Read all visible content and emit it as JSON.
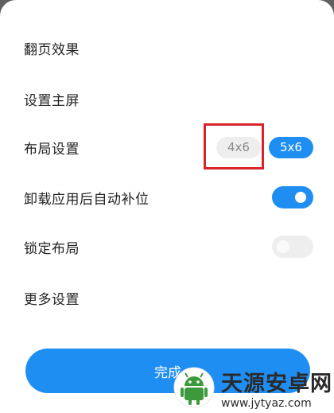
{
  "settings": {
    "page_turn": "翻页效果",
    "set_home": "设置主屏",
    "layout": {
      "label": "布局设置",
      "option_a": "4x6",
      "option_b": "5x6",
      "selected": "5x6"
    },
    "auto_fill": {
      "label": "卸载应用后自动补位",
      "enabled": true
    },
    "lock_layout": {
      "label": "锁定布局",
      "enabled": false
    },
    "more": "更多设置"
  },
  "done_label": "完成",
  "watermark": {
    "name": "天源安卓网",
    "url": "www.jytyaz.com"
  },
  "colors": {
    "accent": "#1f8ef3",
    "highlight": "#d9222a"
  }
}
